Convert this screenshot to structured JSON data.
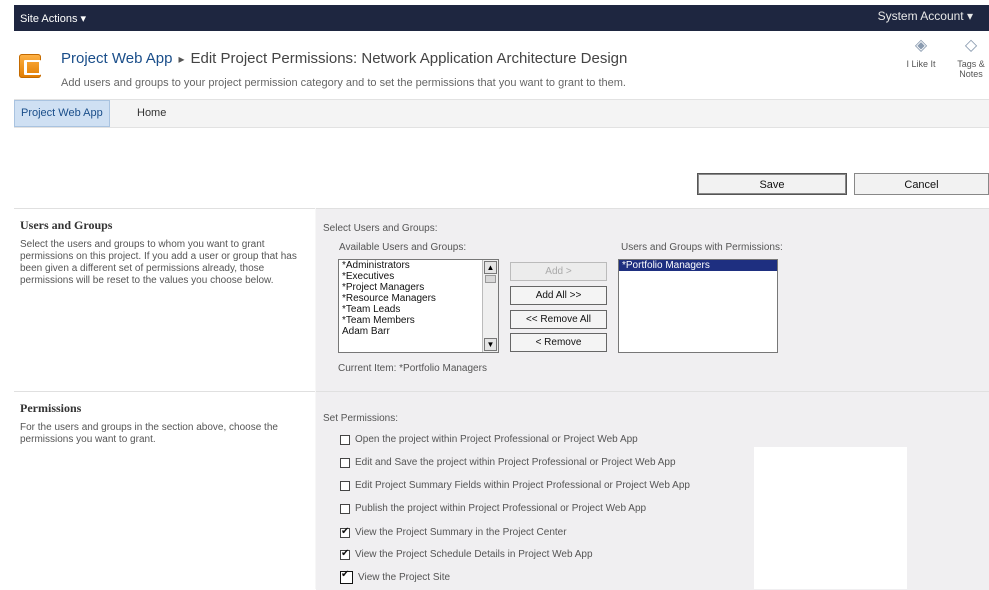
{
  "topbar": {
    "site_actions": "Site Actions ▾",
    "account": "System Account ▾"
  },
  "header": {
    "breadcrumb_app": "Project Web App",
    "breadcrumb_sep": "▸",
    "breadcrumb_page": "Edit Project Permissions: Network Application Architecture Design",
    "subtitle": "Add users and groups to your project permission category and to set the permissions that you want to grant to them.",
    "ilike": "I Like It",
    "tags": "Tags & Notes"
  },
  "nav": {
    "items": [
      "Project Web App",
      "Home"
    ]
  },
  "toolbar": {
    "save": "Save",
    "cancel": "Cancel"
  },
  "users_section": {
    "title": "Users and Groups",
    "description": "Select the users and groups to whom you want to grant permissions on this project. If you add a user or group that has been given a different set of permissions already, those permissions will be reset to the values you choose below.",
    "select_label": "Select Users and Groups:",
    "available_label": "Available Users and Groups:",
    "available": [
      "*Administrators",
      "*Executives",
      "*Project Managers",
      "*Resource Managers",
      "*Team Leads",
      "*Team Members",
      "Adam Barr"
    ],
    "with_perms_label": "Users and Groups with Permissions:",
    "with_perms": [
      "*Portfolio Managers"
    ],
    "buttons": {
      "add": "Add >",
      "add_all": "Add All >>",
      "remove_all": "<< Remove All",
      "remove": "< Remove"
    },
    "current_item": "Current Item: *Portfolio Managers"
  },
  "permissions_section": {
    "title": "Permissions",
    "description": "For the users and groups in the section above, choose the permissions you want to grant.",
    "set_label": "Set Permissions:",
    "items": [
      {
        "label": "Open the project within Project Professional or Project Web App",
        "checked": false
      },
      {
        "label": "Edit and Save the project within Project Professional or Project Web App",
        "checked": false
      },
      {
        "label": "Edit Project Summary Fields within Project Professional or Project Web App",
        "checked": false
      },
      {
        "label": "Publish the project within Project Professional or Project Web App",
        "checked": false
      },
      {
        "label": "View the Project Summary in the Project Center",
        "checked": true
      },
      {
        "label": "View the Project Schedule Details in Project Web App",
        "checked": true
      },
      {
        "label": "View the Project Site",
        "checked": true
      }
    ]
  },
  "colors": {
    "topbar": "#1e2640",
    "link": "#1a4e8a",
    "selected": "#1e2f80",
    "logo": "#f29a1e"
  }
}
